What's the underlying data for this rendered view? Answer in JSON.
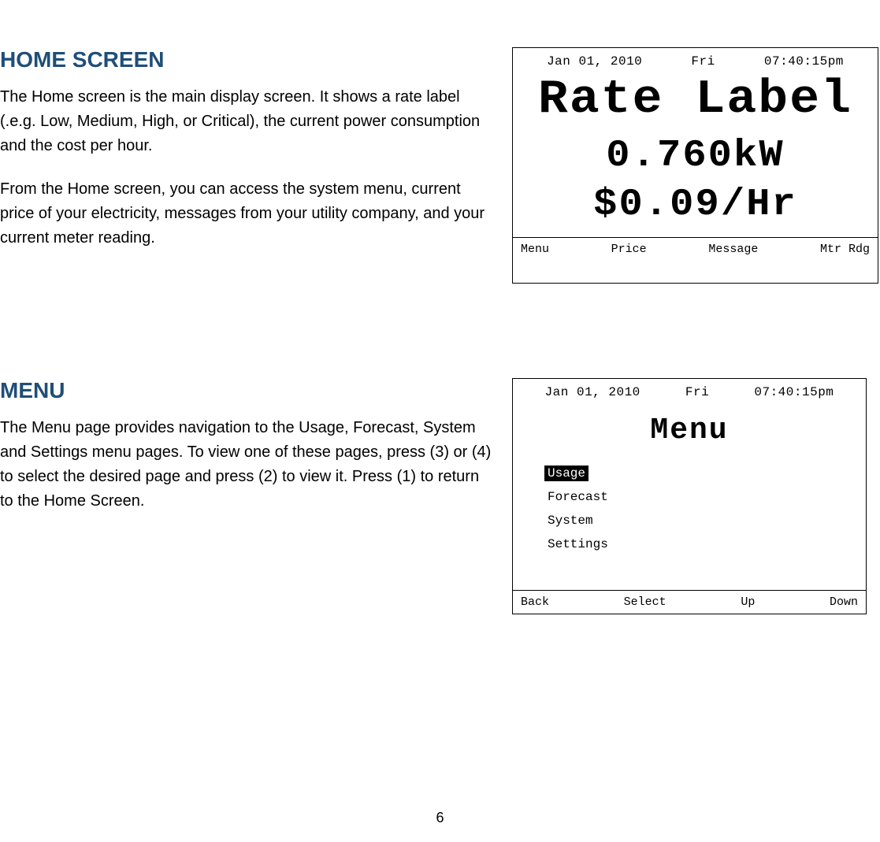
{
  "sections": {
    "home": {
      "heading": "HOME SCREEN",
      "p1": "The Home screen is the main display screen. It shows a rate label (.e.g. Low, Medium, High, or Critical), the current power consumption and the cost per hour.",
      "p2": "From the Home screen, you can access the system menu, current price of your electricity, messages from your utility company, and your current meter reading."
    },
    "menu": {
      "heading": "MENU",
      "p1": "The Menu page provides navigation to the Usage, Forecast, System and Settings menu pages.  To view one of these pages, press (3) or (4) to select the desired page and press (2) to view it.  Press (1) to return to the Home Screen."
    }
  },
  "lcd1": {
    "date": "Jan 01, 2010",
    "day": "Fri",
    "time": "07:40:15pm",
    "line1": "Rate Label",
    "line2": "0.760kW",
    "line3": "$0.09/Hr",
    "soft1": "Menu",
    "soft2": "Price",
    "soft3": "Message",
    "soft4": "Mtr Rdg"
  },
  "lcd2": {
    "date": "Jan 01, 2010",
    "day": "Fri",
    "time": "07:40:15pm",
    "title": "Menu",
    "items": {
      "i1": "Usage",
      "i2": "Forecast",
      "i3": "System",
      "i4": "Settings"
    },
    "soft1": "Back",
    "soft2": "Select",
    "soft3": "Up",
    "soft4": "Down"
  },
  "page_number": "6"
}
